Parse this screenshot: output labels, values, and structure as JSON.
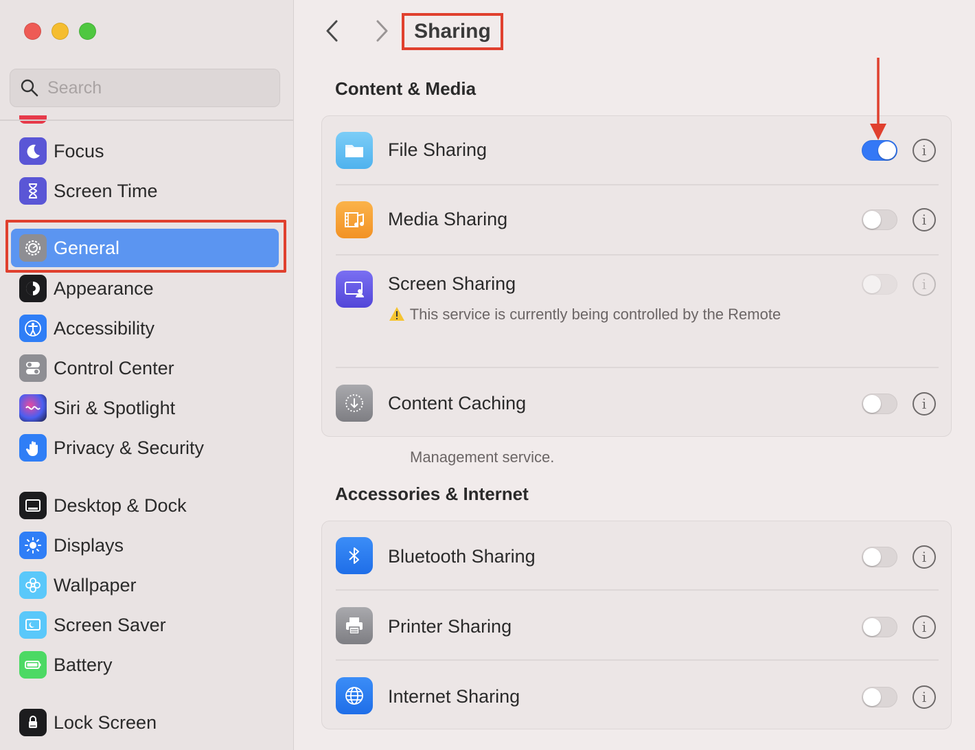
{
  "search": {
    "placeholder": "Search"
  },
  "sidebar": {
    "items": [
      {
        "label": "Focus",
        "icon": "moon-icon"
      },
      {
        "label": "Screen Time",
        "icon": "hourglass-icon"
      },
      {
        "label": "General",
        "icon": "gear-icon",
        "active": true
      },
      {
        "label": "Appearance",
        "icon": "appearance-icon"
      },
      {
        "label": "Accessibility",
        "icon": "accessibility-icon"
      },
      {
        "label": "Control Center",
        "icon": "switches-icon"
      },
      {
        "label": "Siri & Spotlight",
        "icon": "siri-icon"
      },
      {
        "label": "Privacy & Security",
        "icon": "hand-icon"
      },
      {
        "label": "Desktop & Dock",
        "icon": "dock-icon"
      },
      {
        "label": "Displays",
        "icon": "sun-icon"
      },
      {
        "label": "Wallpaper",
        "icon": "flower-icon"
      },
      {
        "label": "Screen Saver",
        "icon": "screen-saver-icon"
      },
      {
        "label": "Battery",
        "icon": "battery-icon"
      },
      {
        "label": "Lock Screen",
        "icon": "lock-icon"
      }
    ]
  },
  "header": {
    "title": "Sharing"
  },
  "sections": [
    {
      "title": "Content & Media",
      "rows": [
        {
          "label": "File Sharing",
          "icon": "folder-icon",
          "on": true
        },
        {
          "label": "Media Sharing",
          "icon": "media-icon",
          "on": false
        },
        {
          "label": "Screen Sharing",
          "icon": "screen-sharing-icon",
          "on": false,
          "disabled": true,
          "warning_line1": "This service is currently being controlled by the Remote",
          "warning_line2": "Management service."
        },
        {
          "label": "Content Caching",
          "icon": "download-icon",
          "on": false
        }
      ]
    },
    {
      "title": "Accessories & Internet",
      "rows": [
        {
          "label": "Bluetooth Sharing",
          "icon": "bluetooth-icon",
          "on": false
        },
        {
          "label": "Printer Sharing",
          "icon": "printer-icon",
          "on": false
        },
        {
          "label": "Internet Sharing",
          "icon": "globe-icon",
          "on": false
        }
      ]
    }
  ],
  "colors": {
    "accent": "#3478f6",
    "highlight": "#e0402e",
    "sidebar_active": "#5b95f1"
  }
}
